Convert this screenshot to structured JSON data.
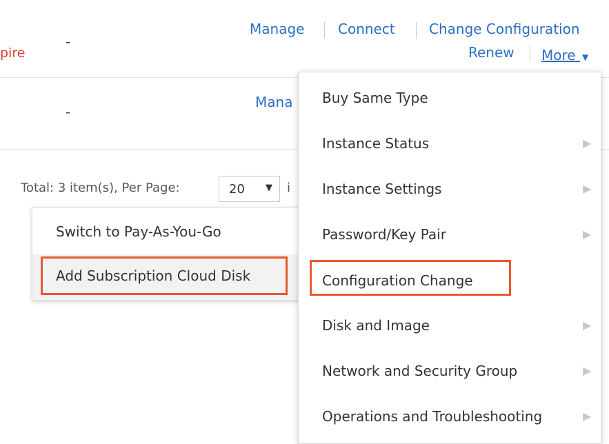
{
  "row1": {
    "status_text": "pire",
    "value": "-",
    "actions": {
      "manage": "Manage",
      "connect": "Connect",
      "change_config": "Change Configuration",
      "renew": "Renew",
      "more": "More"
    }
  },
  "row2": {
    "value": "-",
    "manage_partial": "Mana"
  },
  "pager": {
    "summary": "Total: 3 item(s), Per Page:",
    "per_page": "20",
    "trailing": "i"
  },
  "left_menu": {
    "items": [
      {
        "label": "Switch to Pay-As-You-Go",
        "highlighted": false
      },
      {
        "label": "Add Subscription Cloud Disk",
        "highlighted": true
      }
    ]
  },
  "more_menu": {
    "items": [
      {
        "label": "Buy Same Type",
        "submenu": false
      },
      {
        "label": "Instance Status",
        "submenu": true
      },
      {
        "label": "Instance Settings",
        "submenu": true
      },
      {
        "label": "Password/Key Pair",
        "submenu": true
      },
      {
        "label": "Configuration Change",
        "submenu": false,
        "highlighted": true
      },
      {
        "label": "Disk and Image",
        "submenu": true
      },
      {
        "label": "Network and Security Group",
        "submenu": true
      },
      {
        "label": "Operations and Troubleshooting",
        "submenu": true
      }
    ]
  },
  "colors": {
    "link": "#2b6fc4",
    "expire_red": "#e03c31",
    "highlight_border": "#e9572f"
  }
}
